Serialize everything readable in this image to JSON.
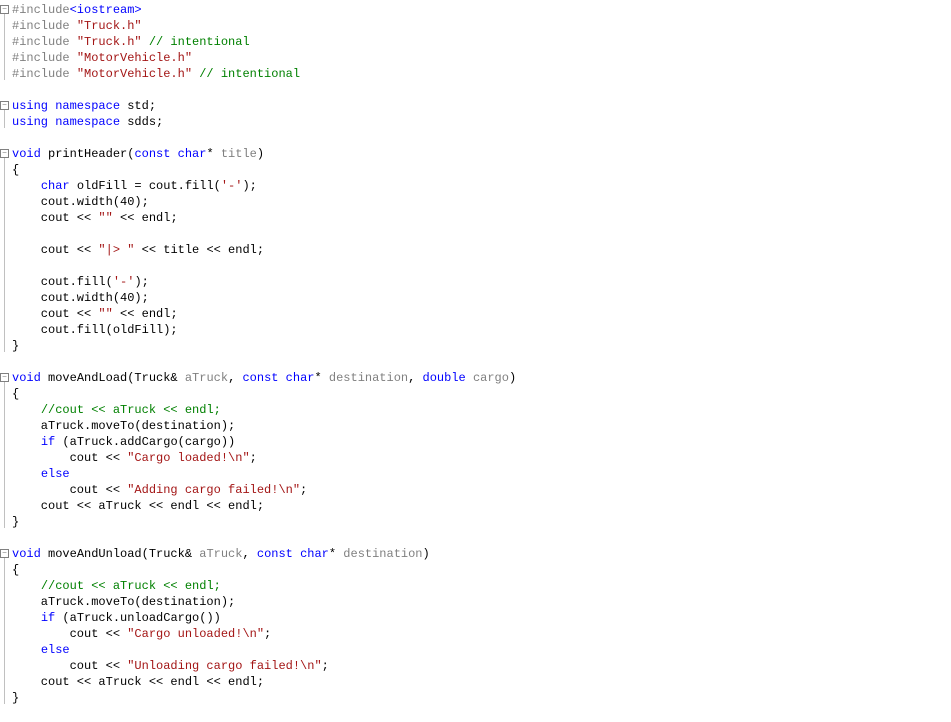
{
  "code": {
    "lines": [
      {
        "fold": true,
        "segments": [
          {
            "t": "#include",
            "c": "c-inactive"
          },
          {
            "t": "<iostream>",
            "c": "c-keyword"
          }
        ]
      },
      {
        "segments": [
          {
            "t": "#include ",
            "c": "c-inactive"
          },
          {
            "t": "\"Truck.h\"",
            "c": "c-string"
          }
        ]
      },
      {
        "segments": [
          {
            "t": "#include ",
            "c": "c-inactive"
          },
          {
            "t": "\"Truck.h\"",
            "c": "c-string"
          },
          {
            "t": " // intentional",
            "c": "c-comment"
          }
        ]
      },
      {
        "segments": [
          {
            "t": "#include ",
            "c": "c-inactive"
          },
          {
            "t": "\"MotorVehicle.h\"",
            "c": "c-string"
          }
        ]
      },
      {
        "segments": [
          {
            "t": "#include ",
            "c": "c-inactive"
          },
          {
            "t": "\"MotorVehicle.h\"",
            "c": "c-string"
          },
          {
            "t": " // intentional",
            "c": "c-comment"
          }
        ]
      },
      {
        "segments": []
      },
      {
        "fold": true,
        "segments": [
          {
            "t": "using namespace",
            "c": "c-keyword"
          },
          {
            "t": " std;",
            "c": ""
          }
        ]
      },
      {
        "segments": [
          {
            "t": "using namespace",
            "c": "c-keyword"
          },
          {
            "t": " sdds;",
            "c": ""
          }
        ]
      },
      {
        "segments": []
      },
      {
        "fold": true,
        "segments": [
          {
            "t": "void",
            "c": "c-keyword"
          },
          {
            "t": " printHeader(",
            "c": ""
          },
          {
            "t": "const char",
            "c": "c-keyword"
          },
          {
            "t": "* ",
            "c": ""
          },
          {
            "t": "title",
            "c": "c-param"
          },
          {
            "t": ")",
            "c": ""
          }
        ]
      },
      {
        "segments": [
          {
            "t": "{",
            "c": ""
          }
        ]
      },
      {
        "segments": [
          {
            "t": "    ",
            "c": ""
          },
          {
            "t": "char",
            "c": "c-keyword"
          },
          {
            "t": " oldFill = cout.fill(",
            "c": ""
          },
          {
            "t": "'-'",
            "c": "c-string"
          },
          {
            "t": ");",
            "c": ""
          }
        ]
      },
      {
        "segments": [
          {
            "t": "    cout.width(40);",
            "c": ""
          }
        ]
      },
      {
        "segments": [
          {
            "t": "    cout << ",
            "c": ""
          },
          {
            "t": "\"\"",
            "c": "c-string"
          },
          {
            "t": " << endl;",
            "c": ""
          }
        ]
      },
      {
        "segments": []
      },
      {
        "segments": [
          {
            "t": "    cout << ",
            "c": ""
          },
          {
            "t": "\"|> \"",
            "c": "c-string"
          },
          {
            "t": " << title << endl;",
            "c": ""
          }
        ]
      },
      {
        "segments": []
      },
      {
        "segments": [
          {
            "t": "    cout.fill(",
            "c": ""
          },
          {
            "t": "'-'",
            "c": "c-string"
          },
          {
            "t": ");",
            "c": ""
          }
        ]
      },
      {
        "segments": [
          {
            "t": "    cout.width(40);",
            "c": ""
          }
        ]
      },
      {
        "segments": [
          {
            "t": "    cout << ",
            "c": ""
          },
          {
            "t": "\"\"",
            "c": "c-string"
          },
          {
            "t": " << endl;",
            "c": ""
          }
        ]
      },
      {
        "segments": [
          {
            "t": "    cout.fill(oldFill);",
            "c": ""
          }
        ]
      },
      {
        "segments": [
          {
            "t": "}",
            "c": ""
          }
        ]
      },
      {
        "segments": []
      },
      {
        "fold": true,
        "segments": [
          {
            "t": "void",
            "c": "c-keyword"
          },
          {
            "t": " moveAndLoad(Truck& ",
            "c": ""
          },
          {
            "t": "aTruck",
            "c": "c-param"
          },
          {
            "t": ", ",
            "c": ""
          },
          {
            "t": "const char",
            "c": "c-keyword"
          },
          {
            "t": "* ",
            "c": ""
          },
          {
            "t": "destination",
            "c": "c-param"
          },
          {
            "t": ", ",
            "c": ""
          },
          {
            "t": "double",
            "c": "c-keyword"
          },
          {
            "t": " ",
            "c": ""
          },
          {
            "t": "cargo",
            "c": "c-param"
          },
          {
            "t": ")",
            "c": ""
          }
        ]
      },
      {
        "segments": [
          {
            "t": "{",
            "c": ""
          }
        ]
      },
      {
        "segments": [
          {
            "t": "    ",
            "c": ""
          },
          {
            "t": "//cout << aTruck << endl;",
            "c": "c-comment"
          }
        ]
      },
      {
        "segments": [
          {
            "t": "    aTruck.moveTo(destination);",
            "c": ""
          }
        ]
      },
      {
        "segments": [
          {
            "t": "    ",
            "c": ""
          },
          {
            "t": "if",
            "c": "c-keyword"
          },
          {
            "t": " (aTruck.addCargo(cargo))",
            "c": ""
          }
        ]
      },
      {
        "segments": [
          {
            "t": "        cout << ",
            "c": ""
          },
          {
            "t": "\"Cargo loaded!\\n\"",
            "c": "c-string"
          },
          {
            "t": ";",
            "c": ""
          }
        ]
      },
      {
        "segments": [
          {
            "t": "    ",
            "c": ""
          },
          {
            "t": "else",
            "c": "c-keyword"
          }
        ]
      },
      {
        "segments": [
          {
            "t": "        cout << ",
            "c": ""
          },
          {
            "t": "\"Adding cargo failed!\\n\"",
            "c": "c-string"
          },
          {
            "t": ";",
            "c": ""
          }
        ]
      },
      {
        "segments": [
          {
            "t": "    cout << aTruck << endl << endl;",
            "c": ""
          }
        ]
      },
      {
        "segments": [
          {
            "t": "}",
            "c": ""
          }
        ]
      },
      {
        "segments": []
      },
      {
        "fold": true,
        "segments": [
          {
            "t": "void",
            "c": "c-keyword"
          },
          {
            "t": " moveAndUnload(Truck& ",
            "c": ""
          },
          {
            "t": "aTruck",
            "c": "c-param"
          },
          {
            "t": ", ",
            "c": ""
          },
          {
            "t": "const char",
            "c": "c-keyword"
          },
          {
            "t": "* ",
            "c": ""
          },
          {
            "t": "destination",
            "c": "c-param"
          },
          {
            "t": ")",
            "c": ""
          }
        ]
      },
      {
        "segments": [
          {
            "t": "{",
            "c": ""
          }
        ]
      },
      {
        "segments": [
          {
            "t": "    ",
            "c": ""
          },
          {
            "t": "//cout << aTruck << endl;",
            "c": "c-comment"
          }
        ]
      },
      {
        "segments": [
          {
            "t": "    aTruck.moveTo(destination);",
            "c": ""
          }
        ]
      },
      {
        "segments": [
          {
            "t": "    ",
            "c": ""
          },
          {
            "t": "if",
            "c": "c-keyword"
          },
          {
            "t": " (aTruck.unloadCargo())",
            "c": ""
          }
        ]
      },
      {
        "segments": [
          {
            "t": "        cout << ",
            "c": ""
          },
          {
            "t": "\"Cargo unloaded!\\n\"",
            "c": "c-string"
          },
          {
            "t": ";",
            "c": ""
          }
        ]
      },
      {
        "segments": [
          {
            "t": "    ",
            "c": ""
          },
          {
            "t": "else",
            "c": "c-keyword"
          }
        ]
      },
      {
        "segments": [
          {
            "t": "        cout << ",
            "c": ""
          },
          {
            "t": "\"Unloading cargo failed!\\n\"",
            "c": "c-string"
          },
          {
            "t": ";",
            "c": ""
          }
        ]
      },
      {
        "segments": [
          {
            "t": "    cout << aTruck << endl << endl;",
            "c": ""
          }
        ]
      },
      {
        "segments": [
          {
            "t": "}",
            "c": ""
          }
        ]
      }
    ]
  }
}
